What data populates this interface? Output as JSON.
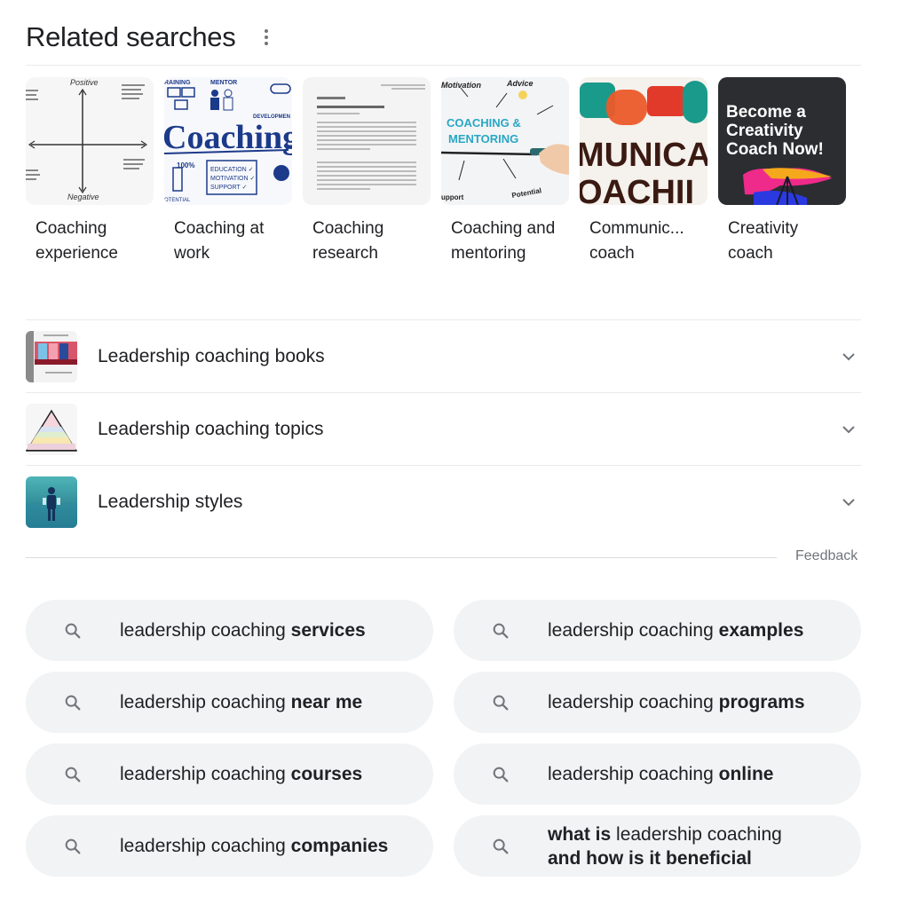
{
  "header": {
    "title": "Related searches",
    "more_icon": "more-vert-icon"
  },
  "cards": [
    {
      "label": "Coaching experience",
      "image": "quadrant-chart-positive-negative"
    },
    {
      "label": "Coaching at work",
      "image": "coaching-doodle"
    },
    {
      "label": "Coaching research",
      "image": "research-paper-page"
    },
    {
      "label": "Coaching and mentoring",
      "image": "coaching-mentoring-whiteboard"
    },
    {
      "label": "Communic... coach",
      "image": "speech-bubbles-communication"
    },
    {
      "label": "Creativity coach",
      "image": "become-a-creativity-coach"
    }
  ],
  "card_image_text": {
    "positive": "Positive",
    "negative": "Negative",
    "coaching": "Coaching",
    "coaching_mentoring_1": "COACHING &",
    "coaching_mentoring_2": "MENTORING",
    "motivation": "Motivation",
    "advice": "Advice",
    "support": "upport",
    "potential": "Potential",
    "communica": "MUNICA",
    "coachi": "OACHII",
    "creativity_1": "Become a",
    "creativity_2": "Creativity",
    "creativity_3": "Coach Now!"
  },
  "list": [
    {
      "label": "Leadership coaching books",
      "icon": "chevron-down-icon"
    },
    {
      "label": "Leadership coaching topics",
      "icon": "chevron-down-icon"
    },
    {
      "label": "Leadership styles",
      "icon": "chevron-down-icon"
    }
  ],
  "feedback": "Feedback",
  "chips": [
    {
      "parts": [
        {
          "t": "leadership coaching ",
          "b": false
        },
        {
          "t": "services",
          "b": true
        }
      ]
    },
    {
      "parts": [
        {
          "t": "leadership coaching ",
          "b": false
        },
        {
          "t": "examples",
          "b": true
        }
      ]
    },
    {
      "parts": [
        {
          "t": "leadership coaching ",
          "b": false
        },
        {
          "t": "near me",
          "b": true
        }
      ]
    },
    {
      "parts": [
        {
          "t": "leadership coaching ",
          "b": false
        },
        {
          "t": "programs",
          "b": true
        }
      ]
    },
    {
      "parts": [
        {
          "t": "leadership coaching ",
          "b": false
        },
        {
          "t": "courses",
          "b": true
        }
      ]
    },
    {
      "parts": [
        {
          "t": "leadership coaching ",
          "b": false
        },
        {
          "t": "online",
          "b": true
        }
      ]
    },
    {
      "parts": [
        {
          "t": "leadership coaching ",
          "b": false
        },
        {
          "t": "companies",
          "b": true
        }
      ]
    },
    {
      "parts": [
        {
          "t": "what is",
          "b": true
        },
        {
          "t": " leadership coaching ",
          "b": false
        },
        {
          "t": "and how is it beneficial",
          "b": true
        }
      ]
    }
  ],
  "colors": {
    "text": "#202124",
    "secondary": "#70757a",
    "chip_bg": "#f1f3f4",
    "divider": "#e8eaed"
  }
}
